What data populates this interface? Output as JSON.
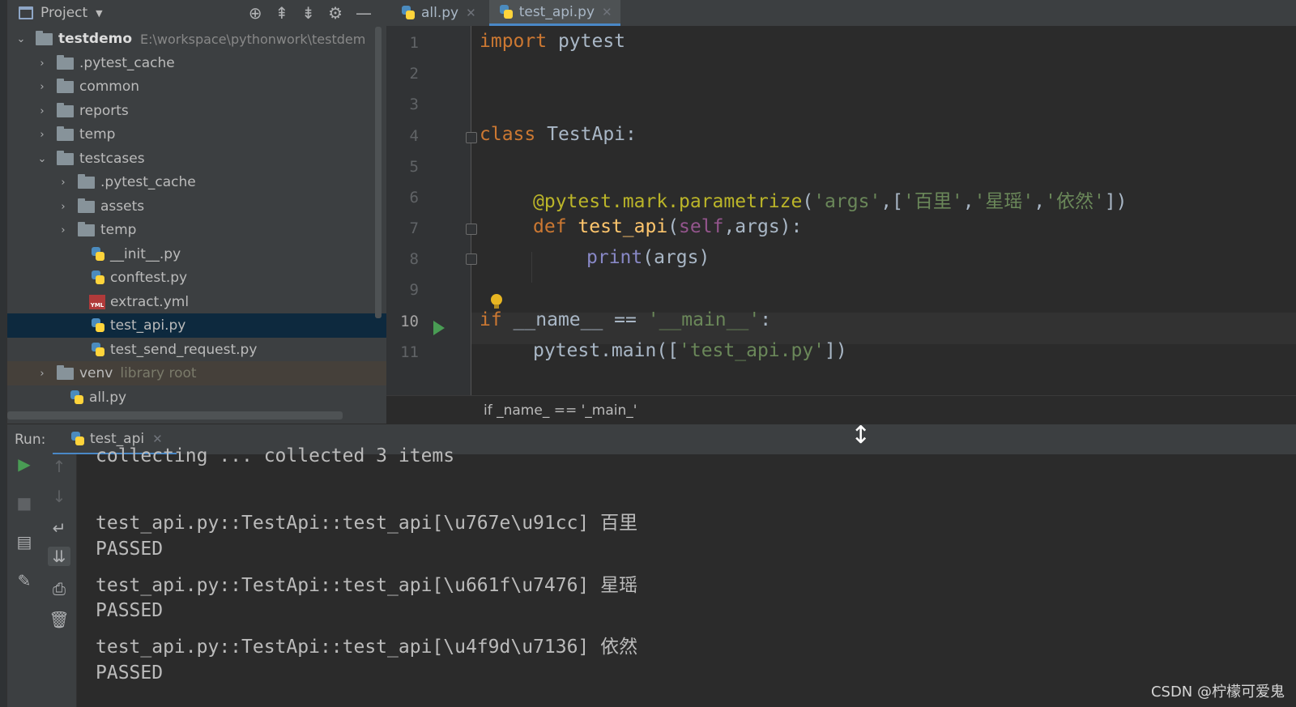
{
  "project_panel": {
    "title": "Project",
    "tree": [
      {
        "label": "testdemo",
        "path": "E:\\workspace\\pythonwork\\testdem",
        "kind": "folder",
        "expanded": true
      },
      {
        "label": ".pytest_cache",
        "kind": "folder"
      },
      {
        "label": "common",
        "kind": "folder"
      },
      {
        "label": "reports",
        "kind": "folder"
      },
      {
        "label": "temp",
        "kind": "folder"
      },
      {
        "label": "testcases",
        "kind": "folder",
        "expanded": true
      },
      {
        "label": ".pytest_cache",
        "kind": "folder"
      },
      {
        "label": "assets",
        "kind": "folder"
      },
      {
        "label": "temp",
        "kind": "folder"
      },
      {
        "label": "__init__.py",
        "kind": "python"
      },
      {
        "label": "conftest.py",
        "kind": "python"
      },
      {
        "label": "extract.yml",
        "kind": "yaml",
        "badge": "YML"
      },
      {
        "label": "test_api.py",
        "kind": "python",
        "selected": true
      },
      {
        "label": "test_send_request.py",
        "kind": "python"
      },
      {
        "label": "venv",
        "suffix": "library root",
        "kind": "folder"
      },
      {
        "label": "all.py",
        "kind": "python"
      }
    ]
  },
  "editor": {
    "tabs": [
      {
        "label": "all.py",
        "active": false
      },
      {
        "label": "test_api.py",
        "active": true
      }
    ],
    "line_numbers": [
      "1",
      "2",
      "3",
      "4",
      "5",
      "6",
      "7",
      "8",
      "9",
      "10",
      "11"
    ],
    "current_line": 10,
    "code": {
      "l1_kw": "import",
      "l1_rest": " pytest",
      "l4_kw": "class",
      "l4_rest": " TestApi:",
      "l6_dec": "@pytest.mark.parametrize",
      "l6_p1": "(",
      "l6_s1": "'args'",
      "l6_p2": ",[",
      "l6_s2": "'百里'",
      "l6_p3": ",",
      "l6_s3": "'星瑶'",
      "l6_p4": ",",
      "l6_s4": "'依然'",
      "l6_p5": "])",
      "l7_kw": "def",
      "l7_fn": "test_api",
      "l7_p1": "(",
      "l7_self": "self",
      "l7_p2": ",args):",
      "l8_bi": "print",
      "l8_rest": "(args)",
      "l10_kw": "if",
      "l10_mid": " __name__ == ",
      "l10_str": "'__main__'",
      "l10_end": ":",
      "l11_pre": "pytest.main([",
      "l11_str": "'test_api.py'",
      "l11_end": "])"
    },
    "breadcrumb": "if _name_ == '_main_'"
  },
  "run_panel": {
    "label": "Run:",
    "tab": "test_api",
    "output": [
      "collecting ... collected 3 items",
      "",
      "test_api.py::TestApi::test_api[\\u767e\\u91cc] 百里",
      "PASSED",
      "test_api.py::TestApi::test_api[\\u661f\\u7476] 星瑶",
      "PASSED",
      "test_api.py::TestApi::test_api[\\u4f9d\\u7136] 依然",
      "PASSED"
    ]
  },
  "watermark": "CSDN @柠檬可爱鬼",
  "colors": {
    "keyword": "#cc7832",
    "string": "#6a8759",
    "decorator": "#bbb529",
    "function": "#ffc66d",
    "self": "#94558d",
    "builtin": "#8888c6",
    "selection": "#0d293e",
    "run_green": "#499c54"
  }
}
